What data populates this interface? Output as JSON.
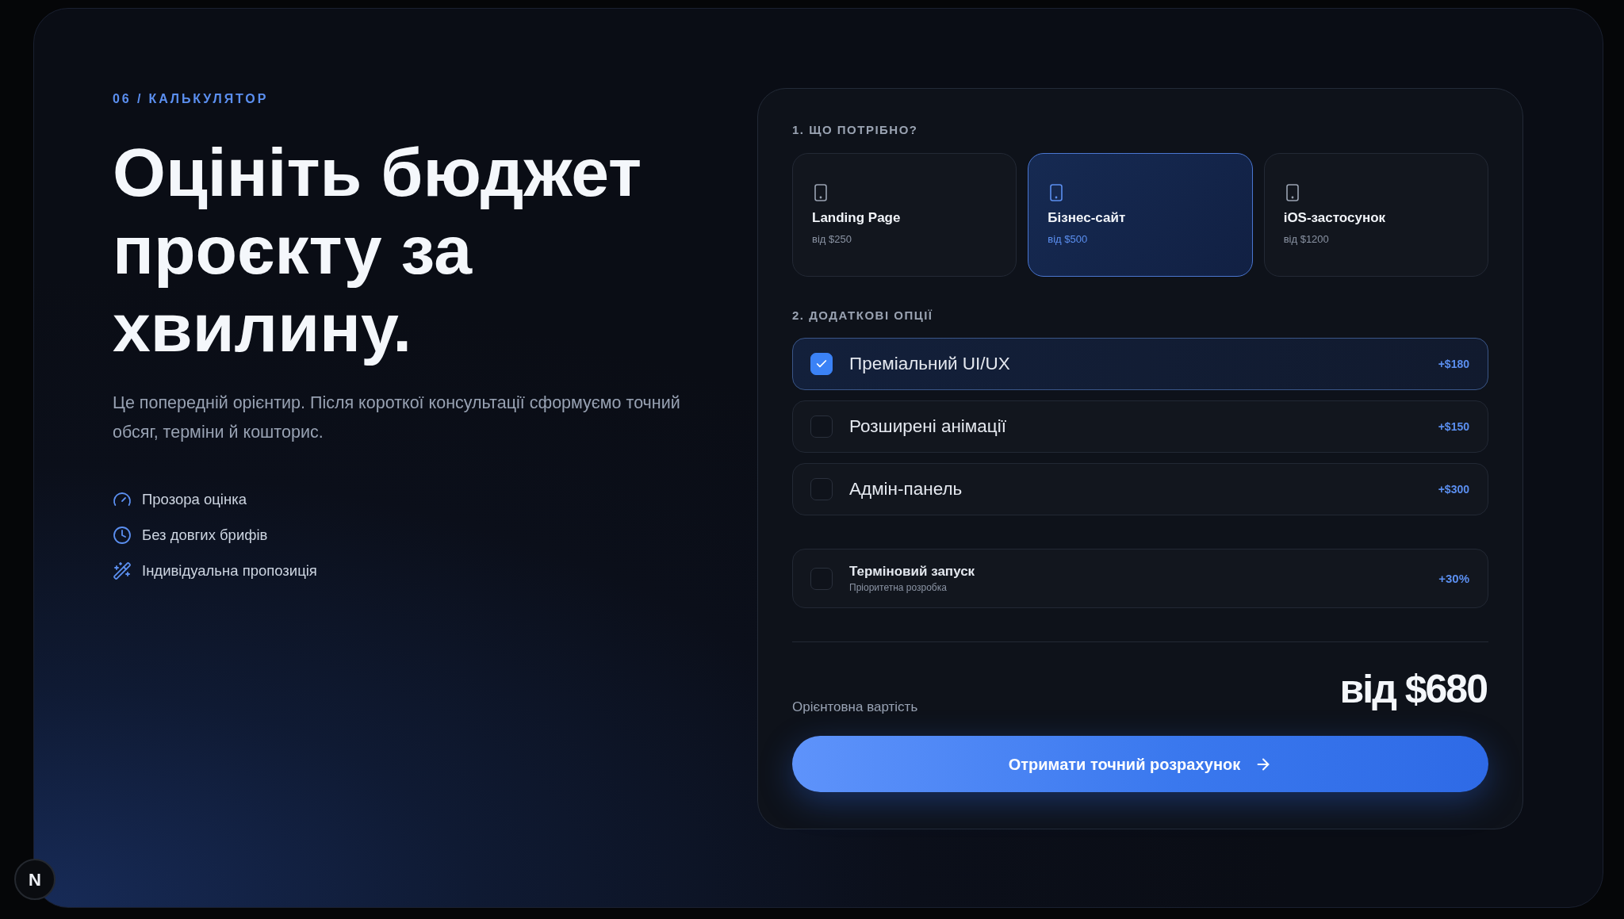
{
  "section_label": "06 / КАЛЬКУЛЯТОР",
  "heading": "Оцініть бюджет проєкту за хвилину.",
  "description": "Це попередній орієнтир. Після короткої консультації сформуємо точний обсяг, терміни й кошторис.",
  "features": [
    "Прозора оцінка",
    "Без довгих брифів",
    "Індивідуальна пропозиція"
  ],
  "calculator": {
    "step_1": {
      "title": "1. ЩО ПОТРІБНО?",
      "project_types": [
        {
          "name": "Landing Page",
          "price": "від $250",
          "selected": false
        },
        {
          "name": "Бізнес-сайт",
          "price": "від $500",
          "selected": true
        },
        {
          "name": "iOS-застосунок",
          "price": "від $1200",
          "selected": false
        }
      ]
    },
    "step_2": {
      "title": "2. ДОДАТКОВІ ОПЦІЇ",
      "options": [
        {
          "label": "Преміальний UI/UX",
          "price": "+$180",
          "checked": true
        },
        {
          "label": "Розширені анімації",
          "price": "+$150",
          "checked": false
        },
        {
          "label": "Адмін-панель",
          "price": "+$300",
          "checked": false
        }
      ]
    },
    "urgent_option": {
      "title": "Терміновий запуск",
      "subtitle": "Пріоритетна розробка",
      "price": "+30%",
      "checked": false
    },
    "total": {
      "label": "Орієнтовна вартість",
      "value": "від $680"
    },
    "submit_button": {
      "label": "Отримати точний розрахунок"
    }
  },
  "dev_badge": {
    "label": "N"
  }
}
